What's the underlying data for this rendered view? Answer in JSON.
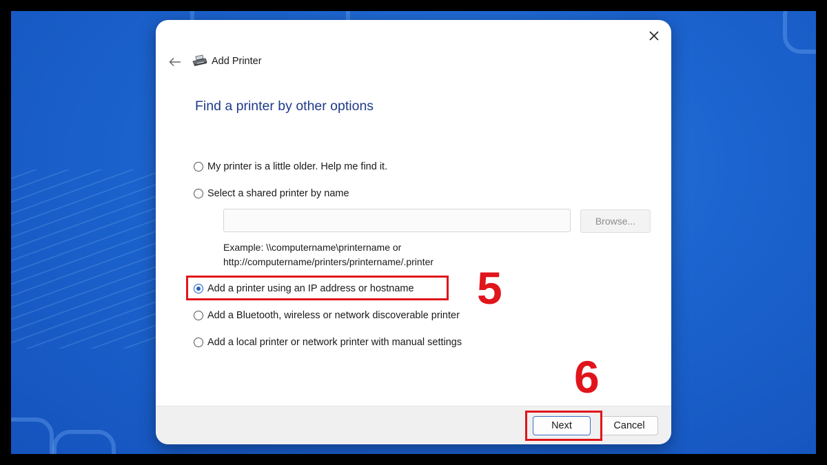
{
  "window": {
    "title": "Add Printer",
    "heading": "Find a printer by other options"
  },
  "options": [
    {
      "label": "My printer is a little older. Help me find it.",
      "checked": false
    },
    {
      "label": "Select a shared printer by name",
      "checked": false
    },
    {
      "label": "Add a printer using an IP address or hostname",
      "checked": true
    },
    {
      "label": "Add a Bluetooth, wireless or network discoverable printer",
      "checked": false
    },
    {
      "label": "Add a local printer or network printer with manual settings",
      "checked": false
    }
  ],
  "shared_printer": {
    "input_value": "",
    "browse_label": "Browse...",
    "example_line1": "Example: \\\\computername\\printername or",
    "example_line2": "http://computername/printers/printername/.printer"
  },
  "footer": {
    "next_label": "Next",
    "cancel_label": "Cancel"
  },
  "annotations": {
    "step5": "5",
    "step6": "6"
  },
  "colors": {
    "highlight": "#e0151b",
    "heading": "#1e3a8a",
    "background": "#1c64cf"
  },
  "icons": [
    "close-icon",
    "back-arrow-icon",
    "printer-icon"
  ]
}
